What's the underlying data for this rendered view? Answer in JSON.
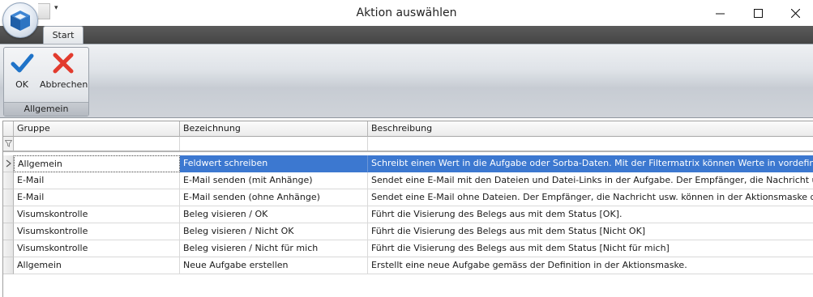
{
  "window": {
    "title": "Aktion auswählen"
  },
  "ribbon": {
    "tab": "Start",
    "group_label": "Allgemein",
    "ok_label": "OK",
    "cancel_label": "Abbrechen"
  },
  "grid": {
    "headers": [
      "Gruppe",
      "Bezeichnung",
      "Beschreibung"
    ],
    "rows": [
      {
        "gruppe": "Allgemein",
        "bezeichnung": "Feldwert schreiben",
        "beschreibung": "Schreibt einen Wert in die Aufgabe oder Sorba-Daten. Mit der Filtermatrix können Werte in vordefinierten Tabe...",
        "selected": true
      },
      {
        "gruppe": "E-Mail",
        "bezeichnung": "E-Mail senden (mit Anhänge)",
        "beschreibung": "Sendet eine E-Mail mit den Dateien und Datei-Links in der Aufgabe. Der Empfänger, die Nachricht usw. können i..."
      },
      {
        "gruppe": "E-Mail",
        "bezeichnung": "E-Mail senden (ohne Anhänge)",
        "beschreibung": "Sendet eine E-Mail ohne Dateien. Der Empfänger, die Nachricht usw. können in der Aktionsmaske definiert wer..."
      },
      {
        "gruppe": "Visumskontrolle",
        "bezeichnung": "Beleg visieren / OK",
        "beschreibung": "Führt die Visierung des Belegs aus mit dem Status [OK]."
      },
      {
        "gruppe": "Visumskontrolle",
        "bezeichnung": "Beleg visieren / Nicht OK",
        "beschreibung": "Führt die Visierung des Belegs aus mit dem Status [Nicht OK]"
      },
      {
        "gruppe": "Visumskontrolle",
        "bezeichnung": "Beleg visieren / Nicht für mich",
        "beschreibung": "Führt die Visierung des Belegs aus mit dem Status [Nicht für mich]"
      },
      {
        "gruppe": "Allgemein",
        "bezeichnung": "Neue Aufgabe erstellen",
        "beschreibung": "Erstellt eine neue Aufgabe gemäss der Definition in der Aktionsmaske."
      }
    ]
  },
  "colors": {
    "selection": "#3c78d0",
    "ok_check": "#1f73c8",
    "cancel_x": "#e23b2e"
  }
}
